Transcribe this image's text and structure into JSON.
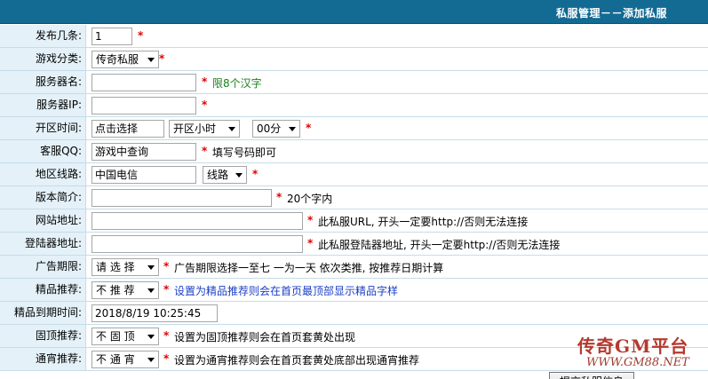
{
  "header": {
    "title": "私服管理－－添加私服"
  },
  "form": {
    "publish_count": {
      "label": "发布几条:",
      "value": "1"
    },
    "game_category": {
      "label": "游戏分类:",
      "selected": "传奇私服"
    },
    "server_name": {
      "label": "服务器名:",
      "value": "",
      "hint": "限8个汉字"
    },
    "server_ip": {
      "label": "服务器IP:",
      "value": ""
    },
    "open_time": {
      "label": "开区时间:",
      "date_value": "点击选择",
      "hour_selected": "开区小时",
      "minute_selected": "00分"
    },
    "service_qq": {
      "label": "客服QQ:",
      "value": "游戏中查询",
      "hint": "填写号码即可"
    },
    "region_line": {
      "label": "地区线路:",
      "value": "中国电信",
      "line_selected": "线路"
    },
    "intro": {
      "label": "版本简介:",
      "value": "",
      "hint": "20个字内"
    },
    "website": {
      "label": "网站地址:",
      "value": "",
      "hint": "此私服URL, 开头一定要http://否则无法连接"
    },
    "launcher_url": {
      "label": "登陆器地址:",
      "value": "",
      "hint": "此私服登陆器地址, 开头一定要http://否则无法连接"
    },
    "ad_period": {
      "label": "广告期限:",
      "selected": "请 选 择",
      "hint": "广告期限选择一至七 一为一天 依次类推, 按推荐日期计算"
    },
    "featured": {
      "label": "精品推荐:",
      "selected": "不 推 荐",
      "hint": "设置为精品推荐则会在首页最顶部显示精品字样"
    },
    "featured_expire": {
      "label": "精品到期时间:",
      "value": "2018/8/19 10:25:45"
    },
    "pinned": {
      "label": "固顶推荐:",
      "selected": "不 固 顶",
      "hint": "设置为固顶推荐则会在首页套黄处出现"
    },
    "banner": {
      "label": "通宵推荐:",
      "selected": "不 通 宵",
      "hint": "设置为通宵推荐则会在首页套黄处底部出现通宵推荐"
    },
    "required_mark": "*",
    "submit_label": "提交私服信息"
  },
  "watermark": {
    "title": "传奇GM平台",
    "url": "WWW.GM88.NET"
  }
}
